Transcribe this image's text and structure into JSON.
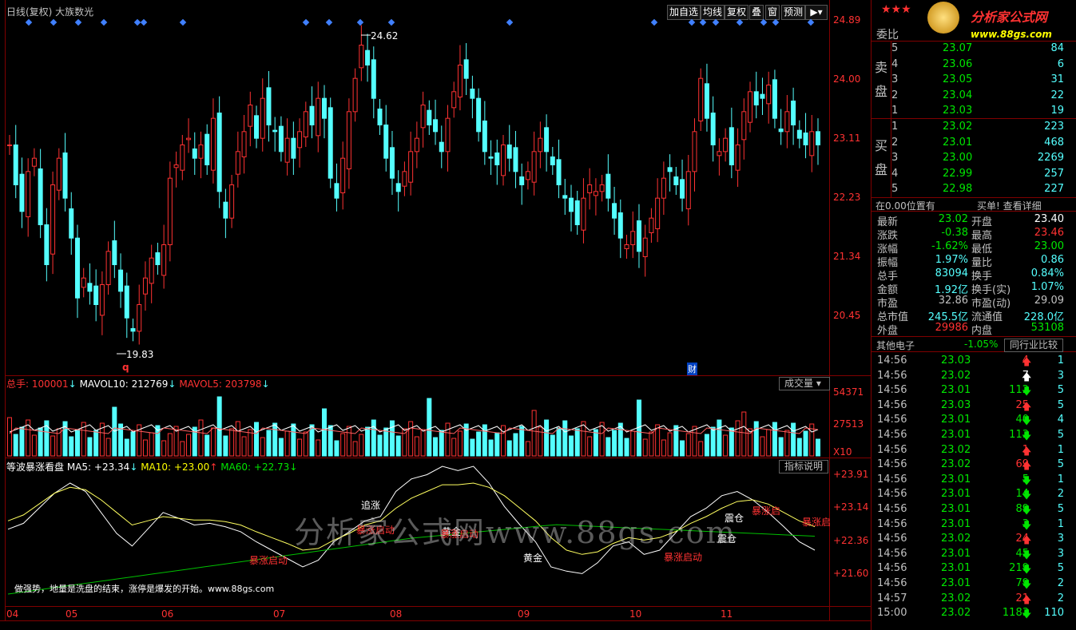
{
  "chart_title": "日线(复权)  大族数光",
  "toolbar": [
    "加自选",
    "均线",
    "复权",
    "叠",
    "窗",
    "预测"
  ],
  "brand": {
    "name": "分析家公式网",
    "url": "www.88gs.com"
  },
  "price_axis": [
    "24.89",
    "24.00",
    "23.11",
    "22.23",
    "21.34",
    "20.45"
  ],
  "price_high": "24.62",
  "price_low": "19.83",
  "marker_q": "q",
  "marker_cai": "财",
  "volume_header": {
    "label": "总手: 100001",
    "mavol10": "MAVOL10: 212769",
    "mavol5": "MAVOL5: 203798",
    "button": "成交量"
  },
  "volume_axis": [
    "54371",
    "27513",
    "X10"
  ],
  "indicator_header": {
    "name": "等波暴涨看盘",
    "ma5": "MA5: +23.34",
    "ma10": "MA10: +23.00",
    "ma60": "MA60: +22.73",
    "button": "指标说明"
  },
  "indicator_axis": [
    "+23.91",
    "+23.14",
    "+22.36",
    "+21.60"
  ],
  "indicator_labels": {
    "zhui_zhang": "追涨",
    "bao_zhang_1": "暴涨启动",
    "huang_jin_1": "黄金",
    "bao_zhang_2": "暴涨启动",
    "huang_jin_2": "黄金",
    "bao_zhang_3": "暴涨启动",
    "zhen_cang_1": "震仓",
    "bao_zhang_4": "暴涨启动",
    "zhen_cang_2": "震仓",
    "bao_zhang_5": "暴涨启"
  },
  "watermark": "分析家公式网www.88gs.com",
  "footer_note": "做强势，地量是洗盘的结束，涨停是爆发的开始。www.88gs.com",
  "x_axis": [
    "04",
    "05",
    "06",
    "07",
    "08",
    "09",
    "10",
    "11"
  ],
  "order_book": {
    "header": "委比",
    "sell_label": [
      "卖",
      "盘"
    ],
    "buy_label": [
      "买",
      "盘"
    ],
    "sell": [
      {
        "lvl": "5",
        "price": "23.07",
        "vol": "84"
      },
      {
        "lvl": "4",
        "price": "23.06",
        "vol": "6"
      },
      {
        "lvl": "3",
        "price": "23.05",
        "vol": "31"
      },
      {
        "lvl": "2",
        "price": "23.04",
        "vol": "22"
      },
      {
        "lvl": "1",
        "price": "23.03",
        "vol": "19"
      }
    ],
    "buy": [
      {
        "lvl": "1",
        "price": "23.02",
        "vol": "223"
      },
      {
        "lvl": "2",
        "price": "23.01",
        "vol": "468"
      },
      {
        "lvl": "3",
        "price": "23.00",
        "vol": "2269"
      },
      {
        "lvl": "4",
        "price": "22.99",
        "vol": "257"
      },
      {
        "lvl": "5",
        "price": "22.98",
        "vol": "227"
      }
    ],
    "footer_left": "在0.00位置有",
    "footer_right": "买单! 查看详细"
  },
  "quote": [
    {
      "l1": "最新",
      "v1": "23.02",
      "c1": "green",
      "l2": "开盘",
      "v2": "23.40",
      "c2": "white"
    },
    {
      "l1": "涨跌",
      "v1": "-0.38",
      "c1": "green",
      "l2": "最高",
      "v2": "23.46",
      "c2": "red"
    },
    {
      "l1": "涨幅",
      "v1": "-1.62%",
      "c1": "green",
      "l2": "最低",
      "v2": "23.00",
      "c2": "green"
    },
    {
      "l1": "振幅",
      "v1": "1.97%",
      "c1": "cyan",
      "l2": "量比",
      "v2": "0.86",
      "c2": "cyan"
    },
    {
      "l1": "总手",
      "v1": "83094",
      "c1": "cyan",
      "l2": "换手",
      "v2": "0.84%",
      "c2": "cyan"
    },
    {
      "l1": "金额",
      "v1": "1.92亿",
      "c1": "cyan",
      "l2": "换手(实)",
      "v2": "1.07%",
      "c2": "cyan"
    },
    {
      "l1": "市盈",
      "v1": "32.86",
      "c1": "gray",
      "l2": "市盈(动)",
      "v2": "29.09",
      "c2": "gray"
    },
    {
      "l1": "总市值",
      "v1": "245.5亿",
      "c1": "cyan",
      "l2": "流通值",
      "v2": "228.0亿",
      "c2": "cyan"
    },
    {
      "l1": "外盘",
      "v1": "29986",
      "c1": "red",
      "l2": "内盘",
      "v2": "53108",
      "c2": "green"
    }
  ],
  "sector": {
    "name": "其他电子",
    "change": "-1.05%",
    "button": "同行业比较"
  },
  "ticks": [
    {
      "t": "14:56",
      "p": "23.03",
      "pc": "green",
      "v": "4",
      "d": "up",
      "n": "1"
    },
    {
      "t": "14:56",
      "p": "23.02",
      "pc": "green",
      "v": "7",
      "d": "upw",
      "n": "3"
    },
    {
      "t": "14:56",
      "p": "23.01",
      "pc": "green",
      "v": "112",
      "d": "down",
      "n": "5"
    },
    {
      "t": "14:56",
      "p": "23.03",
      "pc": "green",
      "v": "25",
      "d": "up",
      "n": "5"
    },
    {
      "t": "14:56",
      "p": "23.01",
      "pc": "green",
      "v": "40",
      "d": "down",
      "n": "4"
    },
    {
      "t": "14:56",
      "p": "23.01",
      "pc": "green",
      "v": "113",
      "d": "down",
      "n": "5"
    },
    {
      "t": "14:56",
      "p": "23.02",
      "pc": "green",
      "v": "1",
      "d": "up",
      "n": "1"
    },
    {
      "t": "14:56",
      "p": "23.02",
      "pc": "green",
      "v": "69",
      "d": "up",
      "n": "5"
    },
    {
      "t": "14:56",
      "p": "23.01",
      "pc": "green",
      "v": "5",
      "d": "down",
      "n": "1"
    },
    {
      "t": "14:56",
      "p": "23.01",
      "pc": "green",
      "v": "14",
      "d": "down",
      "n": "2"
    },
    {
      "t": "14:56",
      "p": "23.01",
      "pc": "green",
      "v": "89",
      "d": "down",
      "n": "5"
    },
    {
      "t": "14:56",
      "p": "23.01",
      "pc": "green",
      "v": "3",
      "d": "down",
      "n": "1"
    },
    {
      "t": "14:56",
      "p": "23.02",
      "pc": "green",
      "v": "24",
      "d": "up",
      "n": "3"
    },
    {
      "t": "14:56",
      "p": "23.01",
      "pc": "green",
      "v": "45",
      "d": "down",
      "n": "3"
    },
    {
      "t": "14:56",
      "p": "23.01",
      "pc": "green",
      "v": "219",
      "d": "down",
      "n": "5"
    },
    {
      "t": "14:56",
      "p": "23.01",
      "pc": "green",
      "v": "79",
      "d": "down",
      "n": "2"
    },
    {
      "t": "14:57",
      "p": "23.02",
      "pc": "green",
      "v": "21",
      "d": "up",
      "n": "2"
    },
    {
      "t": "15:00",
      "p": "23.02",
      "pc": "green",
      "v": "1183",
      "d": "down",
      "n": "110"
    }
  ]
}
